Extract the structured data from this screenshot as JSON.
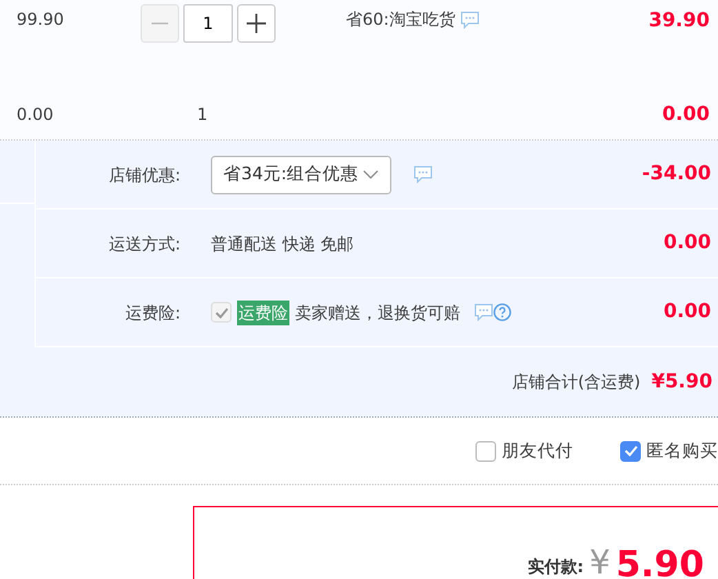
{
  "item_rows": [
    {
      "unit_price": "99.90",
      "quantity": "1",
      "kind": "stepper",
      "minus_disabled": true,
      "promo": "省60:淘宝吃货",
      "subtotal": "39.90"
    },
    {
      "unit_price": "0.00",
      "quantity": "1",
      "kind": "plain",
      "subtotal": "0.00"
    }
  ],
  "shop_rows": [
    {
      "kind": "select",
      "label": "店铺优惠:",
      "value": "省34元:组合优惠",
      "amount": "-34.00"
    },
    {
      "kind": "text",
      "label": "运送方式:",
      "value": "普通配送 快递 免邮",
      "amount": "0.00"
    },
    {
      "kind": "insurance",
      "label": "运费险:",
      "checked": true,
      "disabled": true,
      "tag": "运费险",
      "value": "卖家赠送，退换货可赔",
      "amount": "0.00"
    }
  ],
  "shop_total": {
    "label": "店铺合计(含运费)",
    "value": "¥5.90"
  },
  "options": [
    {
      "label": "朋友代付",
      "checked": false
    },
    {
      "label": "匿名购买",
      "checked": true
    }
  ],
  "payment": {
    "label": "实付款:",
    "currency": "¥",
    "value": "5.90"
  }
}
